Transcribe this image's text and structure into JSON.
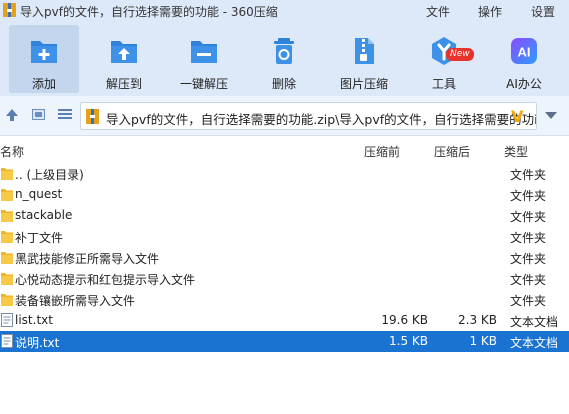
{
  "window": {
    "title": "导入pvf的文件，自行选择需要的功能 - 360压缩",
    "menu": [
      "文件",
      "操作",
      "设置"
    ]
  },
  "toolbar": {
    "buttons": [
      {
        "label": "添加",
        "icon": "add-icon"
      },
      {
        "label": "解压到",
        "icon": "extract-to-icon"
      },
      {
        "label": "一键解压",
        "icon": "one-click-extract-icon"
      },
      {
        "label": "删除",
        "icon": "delete-icon"
      },
      {
        "label": "图片压缩",
        "icon": "image-compress-icon"
      },
      {
        "label": "工具",
        "icon": "tools-icon"
      },
      {
        "label": "AI办公",
        "icon": "ai-office-icon"
      }
    ],
    "new_badge": "New"
  },
  "address": {
    "path": "导入pvf的文件，自行选择需要的功能.zip\\导入pvf的文件，自行选择需要的功i",
    "v_mark": "V"
  },
  "columns": {
    "name": "名称",
    "size": "压缩前",
    "compressed": "压缩后",
    "type": "类型"
  },
  "rows": [
    {
      "name": ".. (上级目录)",
      "size": "",
      "compressed": "",
      "type": "文件夹",
      "icon": "folder-icon"
    },
    {
      "name": "n_quest",
      "size": "",
      "compressed": "",
      "type": "文件夹",
      "icon": "folder-icon"
    },
    {
      "name": "stackable",
      "size": "",
      "compressed": "",
      "type": "文件夹",
      "icon": "folder-icon"
    },
    {
      "name": "补丁文件",
      "size": "",
      "compressed": "",
      "type": "文件夹",
      "icon": "folder-icon"
    },
    {
      "name": "黑武技能修正所需导入文件",
      "size": "",
      "compressed": "",
      "type": "文件夹",
      "icon": "folder-icon"
    },
    {
      "name": "心悦动态提示和红包提示导入文件",
      "size": "",
      "compressed": "",
      "type": "文件夹",
      "icon": "folder-icon"
    },
    {
      "name": "装备镶嵌所需导入文件",
      "size": "",
      "compressed": "",
      "type": "文件夹",
      "icon": "folder-icon"
    },
    {
      "name": "list.txt",
      "size": "19.6 KB",
      "compressed": "2.3 KB",
      "type": "文本文档",
      "icon": "text-file-icon"
    },
    {
      "name": "说明.txt",
      "size": "1.5 KB",
      "compressed": "1 KB",
      "type": "文本文档",
      "icon": "text-file-icon",
      "selected": true
    }
  ]
}
